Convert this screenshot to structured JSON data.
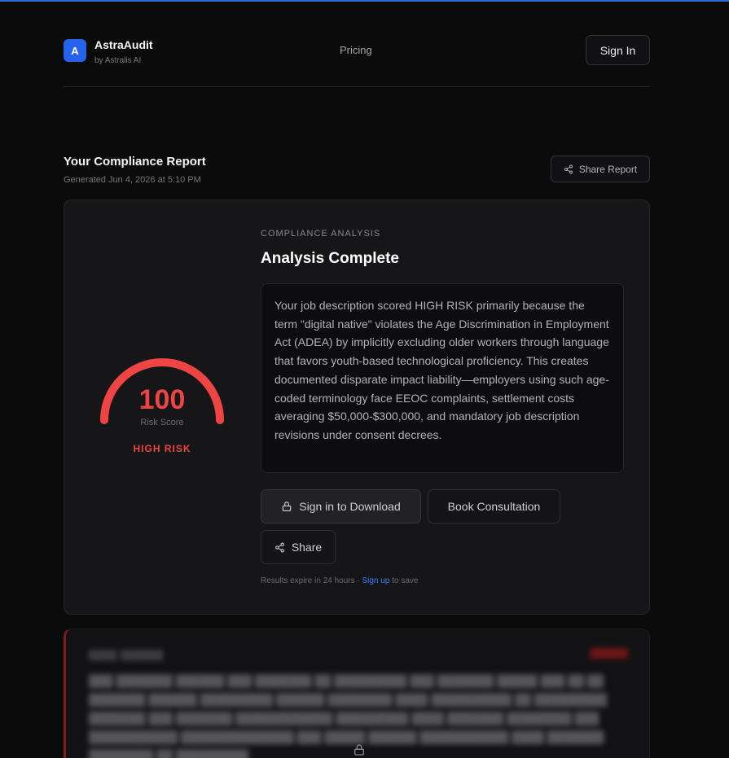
{
  "header": {
    "logo_letter": "A",
    "brand_name": "AstraAudit",
    "brand_sub": "by Astralis AI",
    "nav_pricing": "Pricing",
    "sign_in": "Sign In"
  },
  "report": {
    "title": "Your Compliance Report",
    "generated": "Generated Jun 4, 2026 at 5:10 PM",
    "share_label": "Share Report"
  },
  "analysis": {
    "score": "100",
    "score_fraction": 1.0,
    "score_label": "Risk Score",
    "risk_level": "HIGH RISK",
    "kicker": "COMPLIANCE ANALYSIS",
    "title": "Analysis Complete",
    "summary": "Your job description scored HIGH RISK primarily because the term \"digital native\" violates the Age Discrimination in Employment Act (ADEA) by implicitly excluding older workers through language that favors youth-based technological proficiency. This creates documented disparate impact liability—employers using such age-coded terminology face EEOC complaints, settlement costs averaging $50,000-$300,000, and mandatory job description revisions under consent decrees.",
    "download_label": "Sign in to Download",
    "consult_label": "Book Consultation",
    "share_label": "Share",
    "expire_text": "Results expire in 24 hours · ",
    "signup_link": "Sign up",
    "expire_suffix": " to save"
  },
  "colors": {
    "accent": "#2563eb",
    "risk": "#ef4444",
    "link": "#3b82f6"
  },
  "icons": {
    "share": "share-icon",
    "lock": "lock-icon"
  }
}
